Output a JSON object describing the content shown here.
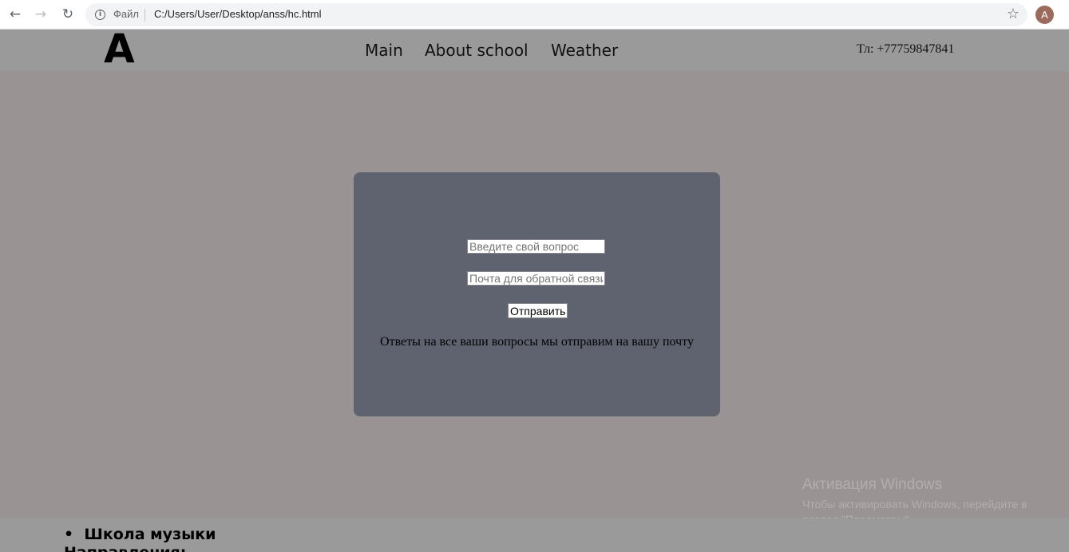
{
  "browser": {
    "file_label": "Файл",
    "url": "C:/Users/User/Desktop/anss/hc.html",
    "avatar_letter": "A",
    "back_icon": "arrow-left-icon",
    "forward_icon": "arrow-right-icon",
    "reload_icon": "reload-icon",
    "info_icon": "info-icon",
    "star_icon": "star-icon"
  },
  "header": {
    "logo": "A",
    "nav": [
      "Main",
      "About school",
      "Weather"
    ],
    "phone": "Тл: +77759847841"
  },
  "form": {
    "question_placeholder": "Введите свой вопрос",
    "email_placeholder": "Почта для обратной связи",
    "submit_label": "Отправить",
    "note": "Ответы на все ваши вопросы мы отправим на вашу почту"
  },
  "watermark": {
    "title": "Активация Windows",
    "subtitle": "Чтобы активировать Windows, перейдите в раздел \"Параметры\"."
  },
  "bottom": {
    "list_item": "Школа музыки",
    "heading": "Направления:"
  },
  "colors": {
    "page_bg": "#999393",
    "header_bg": "#9a9a9a",
    "card_bg": "#5e636f"
  }
}
